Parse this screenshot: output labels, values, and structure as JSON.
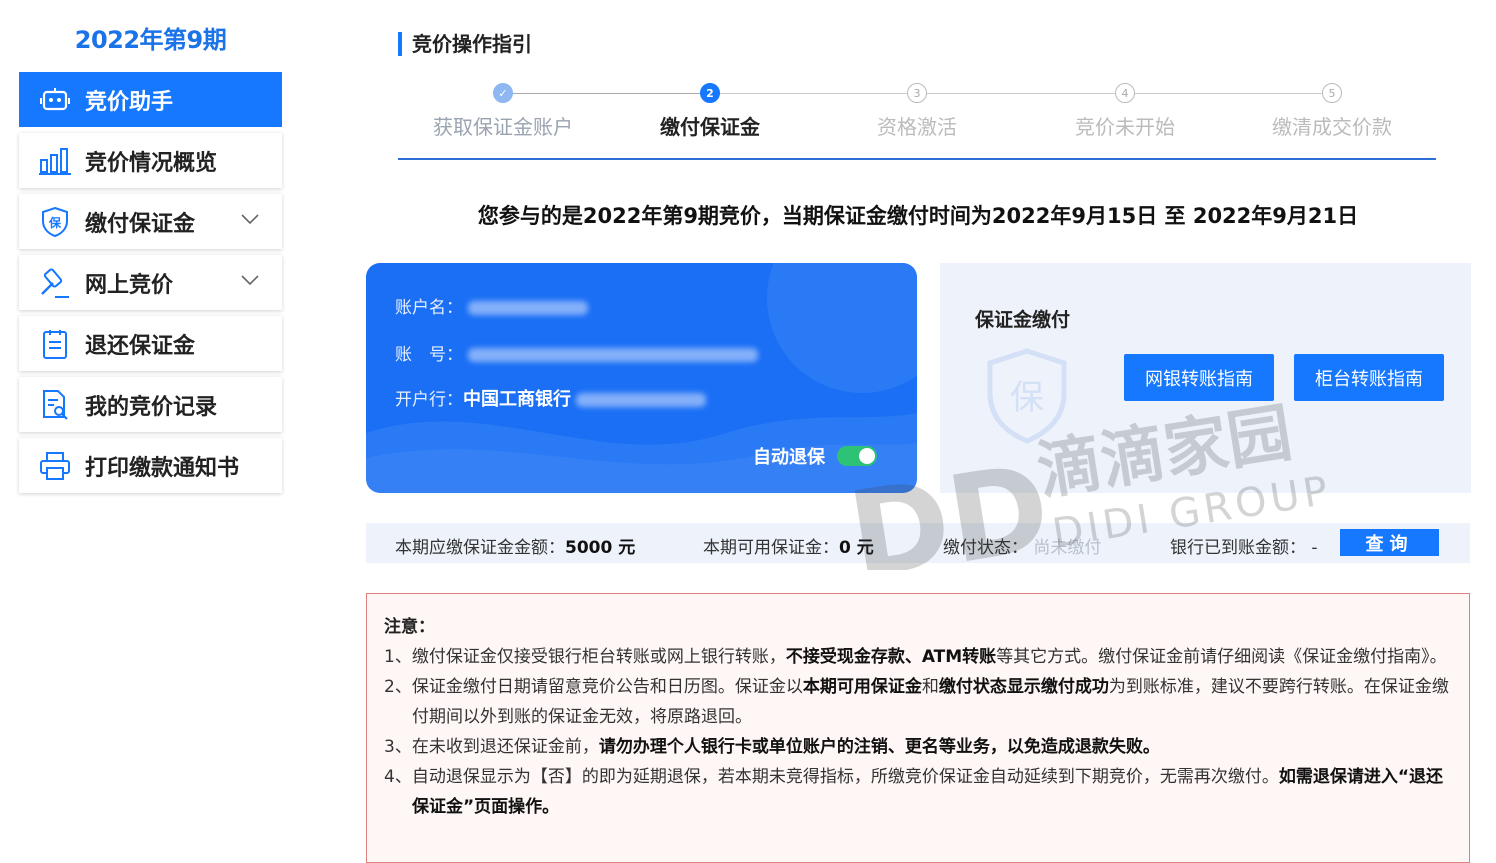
{
  "sidebar": {
    "period": "2022年第9期",
    "items": [
      {
        "label": "竞价助手"
      },
      {
        "label": "竞价情况概览"
      },
      {
        "label": "缴付保证金"
      },
      {
        "label": "网上竞价"
      },
      {
        "label": "退还保证金"
      },
      {
        "label": "我的竞价记录"
      },
      {
        "label": "打印缴款通知书"
      }
    ]
  },
  "main": {
    "section_title": "竞价操作指引",
    "steps": [
      {
        "num": "✓",
        "label": "获取保证金账户",
        "state": "done"
      },
      {
        "num": "2",
        "label": "缴付保证金",
        "state": "current"
      },
      {
        "num": "3",
        "label": "资格激活",
        "state": "todo"
      },
      {
        "num": "4",
        "label": "竞价未开始",
        "state": "todo"
      },
      {
        "num": "5",
        "label": "缴清成交价款",
        "state": "todo"
      }
    ],
    "notice": "您参与的是2022年第9期竞价，当期保证金缴付时间为2022年9月15日 至 2022年9月21日"
  },
  "card": {
    "account_name_label": "账户名：",
    "account_no_label": "账　号：",
    "bank_label": "开户行：",
    "bank_value": "中国工商银行",
    "auto_refund_label": "自动退保",
    "auto_refund_on": true
  },
  "payment": {
    "title": "保证金缴付",
    "online_btn": "网银转账指南",
    "counter_btn": "柜台转账指南"
  },
  "status": {
    "due_label": "本期应缴保证金金额：",
    "due_value": "5000 元",
    "available_label": "本期可用保证金：",
    "available_value": "0 元",
    "state_label": "缴付状态：",
    "state_value": "尚未缴付",
    "received_label": "银行已到账金额：",
    "received_value": "-",
    "query_btn": "查询"
  },
  "watermark": {
    "letters": "DD",
    "cn": "滴滴家园",
    "en": "DIDI GROUP"
  },
  "notes": {
    "title": "注意：",
    "n1_a": "1、缴付保证金仅接受银行柜台转账或网上银行转账，",
    "n1_b": "不接受现金存款、ATM转账",
    "n1_c": "等其它方式。缴付保证金前请仔细阅读《保证金缴付指南》。",
    "n2_a": "2、保证金缴付日期请留意竞价公告和日历图。保证金以",
    "n2_b": "本期可用保证金",
    "n2_c": "和",
    "n2_d": "缴付状态显示缴付成功",
    "n2_e": "为到账标准，建议不要跨行转账。在保证金缴付期间以外到账的保证金无效，将原路退回。",
    "n3_a": "3、在未收到退还保证金前，",
    "n3_b": "请勿办理个人银行卡或单位账户的注销、更名等业务，以免造成退款失败。",
    "n4_a": "4、自动退保显示为【否】的即为延期退保，若本期未竞得指标，所缴竞价保证金自动延续到下期竞价，无需再次缴付。",
    "n4_b": "如需退保请进入“退还保证金”页面操作。"
  },
  "colors": {
    "primary": "#1677ff",
    "notes_border": "#e08080",
    "notes_bg": "#fff6f6"
  }
}
